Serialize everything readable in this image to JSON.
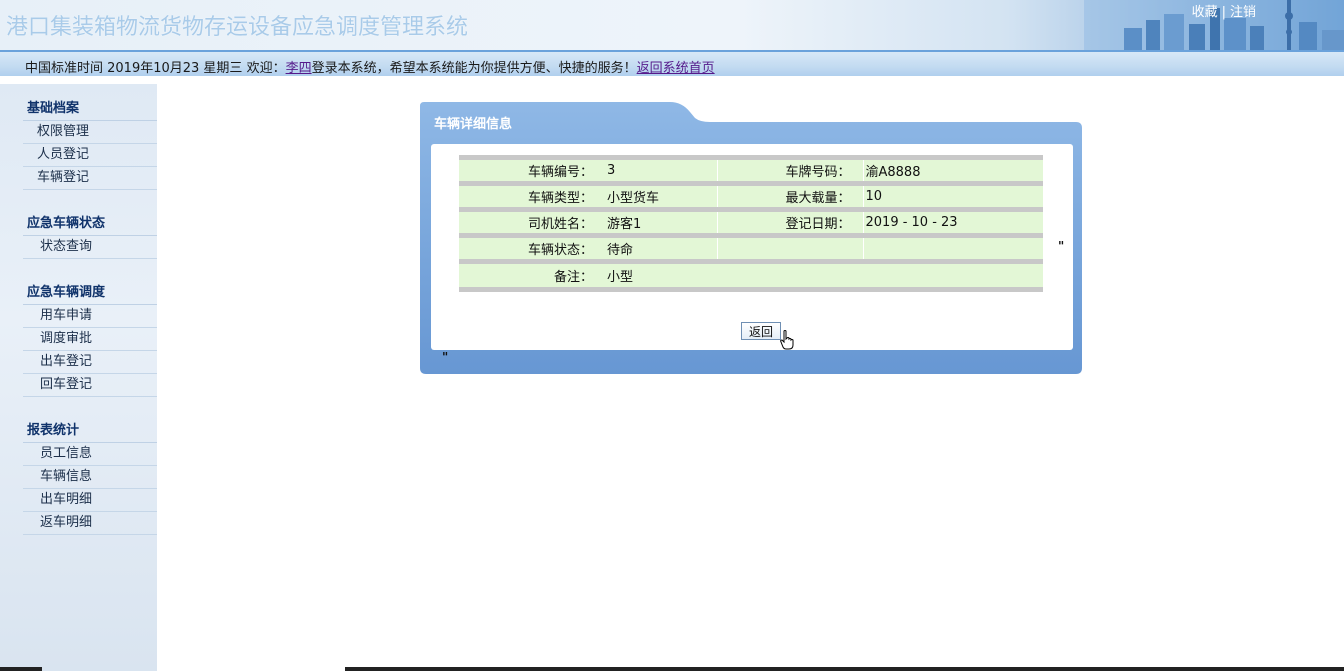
{
  "header": {
    "system_title": "港口集装箱物流货物存运设备应急调度管理系统",
    "link_favorite": "收藏",
    "separator": "|",
    "link_logout": "注销"
  },
  "infobar": {
    "prefix": "中国标准时间 2019年10月23 星期三 欢迎：",
    "user": "李四",
    "message": "登录本系统，希望本系统能为你提供方便、快捷的服务！",
    "home_link": "返回系统首页"
  },
  "sidebar": {
    "groups": [
      {
        "title": "基础档案",
        "items": [
          "权限管理",
          "人员登记",
          "车辆登记"
        ]
      },
      {
        "title": "应急车辆状态",
        "items": [
          "状态查询"
        ]
      },
      {
        "title": "应急车辆调度",
        "items": [
          "用车申请",
          "调度审批",
          "出车登记",
          "回车登记"
        ]
      },
      {
        "title": "报表统计",
        "items": [
          "员工信息",
          "车辆信息",
          "出车明细",
          "返车明细"
        ]
      }
    ]
  },
  "panel": {
    "title": "车辆详细信息",
    "rows": [
      {
        "label1": "车辆编号：",
        "value1": "3",
        "label2": "车牌号码：",
        "value2": "渝A8888"
      },
      {
        "label1": "车辆类型：",
        "value1": "小型货车",
        "label2": "最大载量：",
        "value2": "10"
      },
      {
        "label1": "司机姓名：",
        "value1": "游客1",
        "label2": "登记日期：",
        "value2": "2019 - 10 - 23"
      },
      {
        "label1": "车辆状态：",
        "value1": "待命",
        "label2": "",
        "value2": ""
      }
    ],
    "remark_label": "备注：",
    "remark_value": "小型",
    "back_button": "返回",
    "stray_mark_right": "\"",
    "stray_mark_bottom": "\""
  },
  "colors": {
    "panel_blue": "#7aa7dc",
    "row_green": "#e3f7d6",
    "group_title": "#10336b"
  }
}
